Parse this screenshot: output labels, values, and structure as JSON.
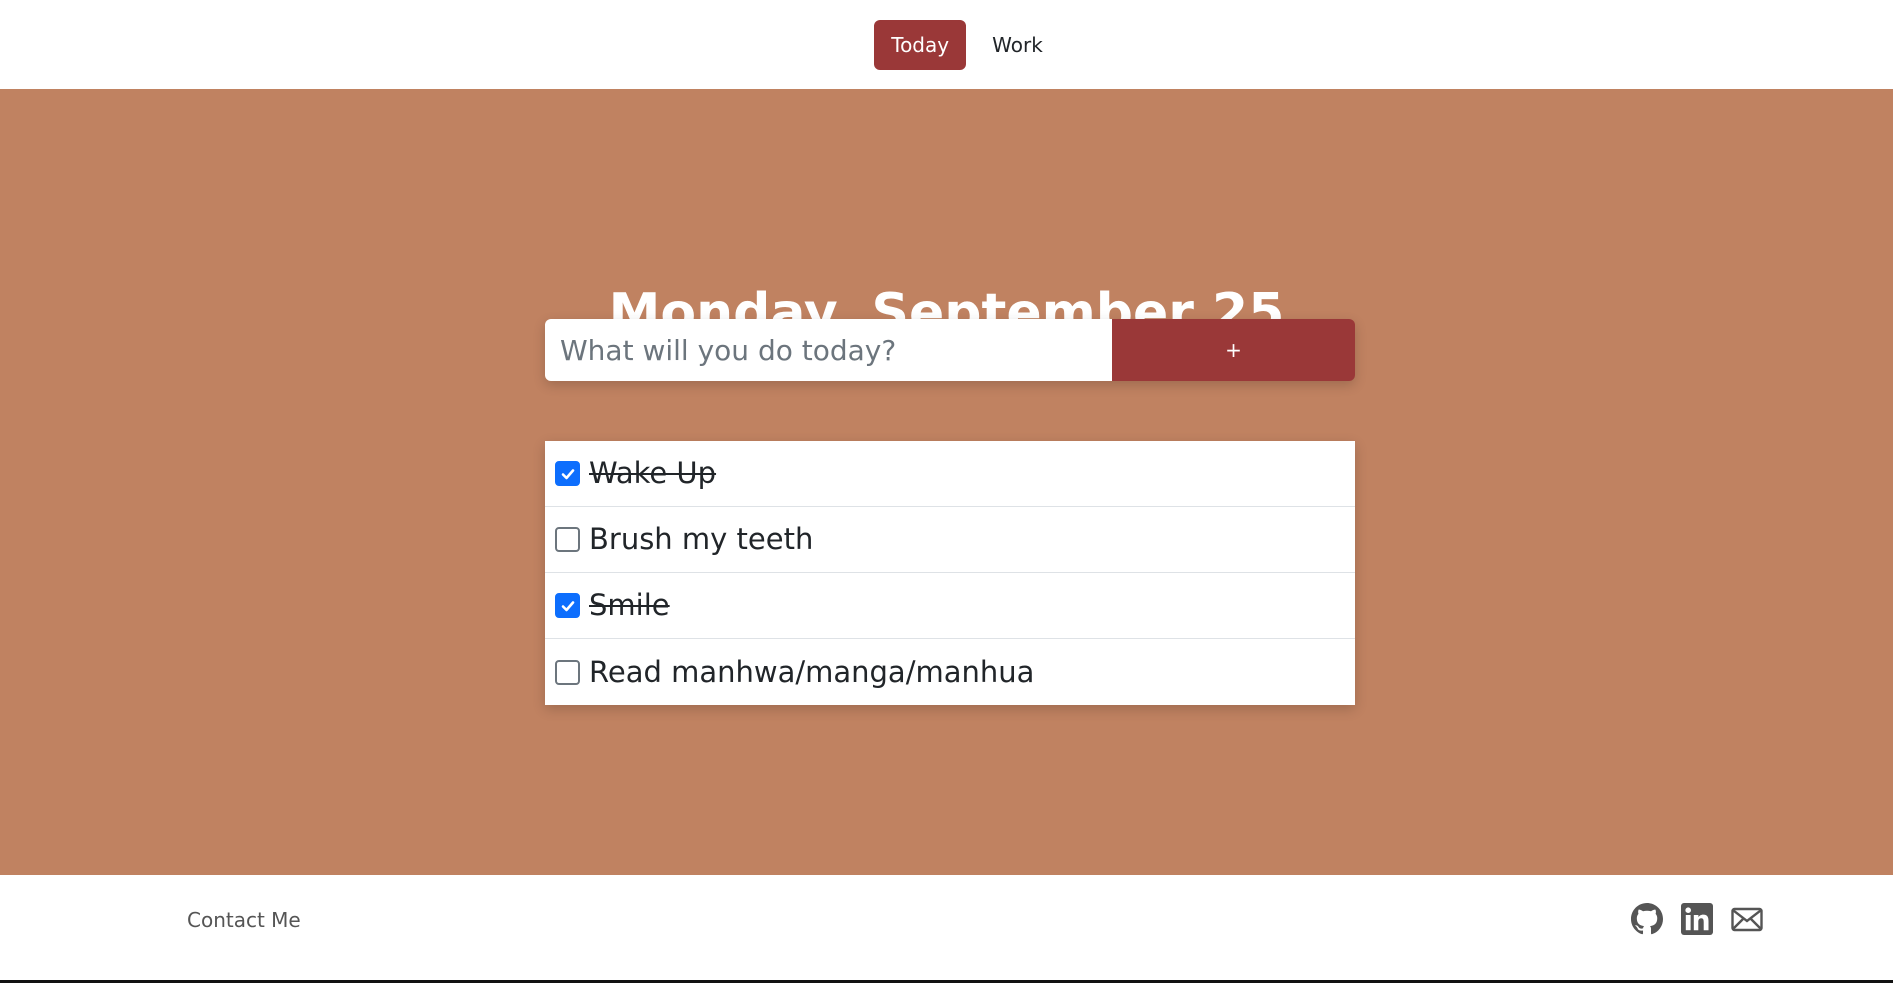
{
  "nav": {
    "tabs": [
      {
        "label": "Today",
        "active": true
      },
      {
        "label": "Work",
        "active": false
      }
    ]
  },
  "main": {
    "title": "Monday, September 25",
    "input": {
      "placeholder": "What will you do today?",
      "value": ""
    },
    "add_label": "+",
    "todos": [
      {
        "text": "Wake Up",
        "checked": true
      },
      {
        "text": "Brush my teeth",
        "checked": false
      },
      {
        "text": "Smile",
        "checked": true
      },
      {
        "text": "Read manhwa/manga/manhua",
        "checked": false
      }
    ]
  },
  "footer": {
    "contact_label": "Contact Me",
    "icons": [
      "github-icon",
      "linkedin-icon",
      "mail-icon"
    ]
  },
  "colors": {
    "accent": "#9a3838",
    "background": "#c08261",
    "checkbox_checked": "#0d6efd"
  }
}
